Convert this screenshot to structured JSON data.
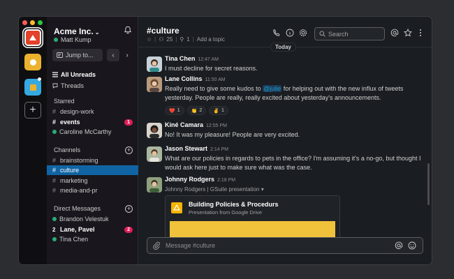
{
  "workspace": {
    "name": "Acme Inc.",
    "user": "Matt Kump",
    "jump_label": "Jump to..."
  },
  "sidebar": {
    "all_unreads": "All Unreads",
    "threads": "Threads",
    "starred_header": "Starred",
    "starred": [
      {
        "label": "design-work",
        "type": "channel",
        "bold": false
      },
      {
        "label": "events",
        "type": "channel",
        "bold": true,
        "badge": "1"
      },
      {
        "label": "Caroline McCarthy",
        "type": "dm",
        "bold": false
      }
    ],
    "channels_header": "Channels",
    "channels": [
      {
        "label": "brainstorming",
        "active": false
      },
      {
        "label": "culture",
        "active": true
      },
      {
        "label": "marketing",
        "active": false
      },
      {
        "label": "media-and-pr",
        "active": false
      }
    ],
    "dms_header": "Direct Messages",
    "dms": [
      {
        "label": "Brandon Velestuk",
        "bold": false
      },
      {
        "label": "Lane, Pavel",
        "bold": true,
        "count": "2",
        "badge": "2"
      },
      {
        "label": "Tina Chen",
        "bold": false
      }
    ]
  },
  "channel": {
    "title": "#culture",
    "members": "25",
    "pins": "1",
    "add_topic": "Add a topic",
    "search_placeholder": "Search",
    "day_divider": "Today"
  },
  "messages": [
    {
      "name": "Tina Chen",
      "time": "12:47 AM",
      "text": "I must decline for secret reasons."
    },
    {
      "name": "Lane Collins",
      "time": "11:50 AM",
      "pre": "Really need to give some kudos to ",
      "mention": "@julie",
      "post": " for helping out with the new influx of tweets yesterday. People are really, really excited about yesterday's announcements.",
      "reactions": [
        {
          "emoji": "❤️",
          "count": "1"
        },
        {
          "emoji": "👏",
          "count": "2"
        },
        {
          "emoji": "✌️",
          "count": "1"
        }
      ]
    },
    {
      "name": "Kiné Camara",
      "time": "12:55 PM",
      "text": "No! It was my pleasure! People are very excited."
    },
    {
      "name": "Jason Stewart",
      "time": "2:14 PM",
      "text": "What are our policies in regards to pets in the office? I'm assuming it's a no-go, but thought I would ask here just to make sure what was the case."
    },
    {
      "name": "Johnny Rodgers",
      "time": "2:18 PM",
      "text": "Johnny Rodgers | GSuite presentation",
      "attachment": {
        "title": "Building Policies & Procedurs",
        "subtitle": "Presentation from Google Drive"
      }
    }
  ],
  "composer": {
    "placeholder": "Message #culture"
  },
  "colors": {
    "active": "#1164a3",
    "badge": "#e01e5a",
    "presence": "#2bac76",
    "mention": "#1d9bd1"
  }
}
